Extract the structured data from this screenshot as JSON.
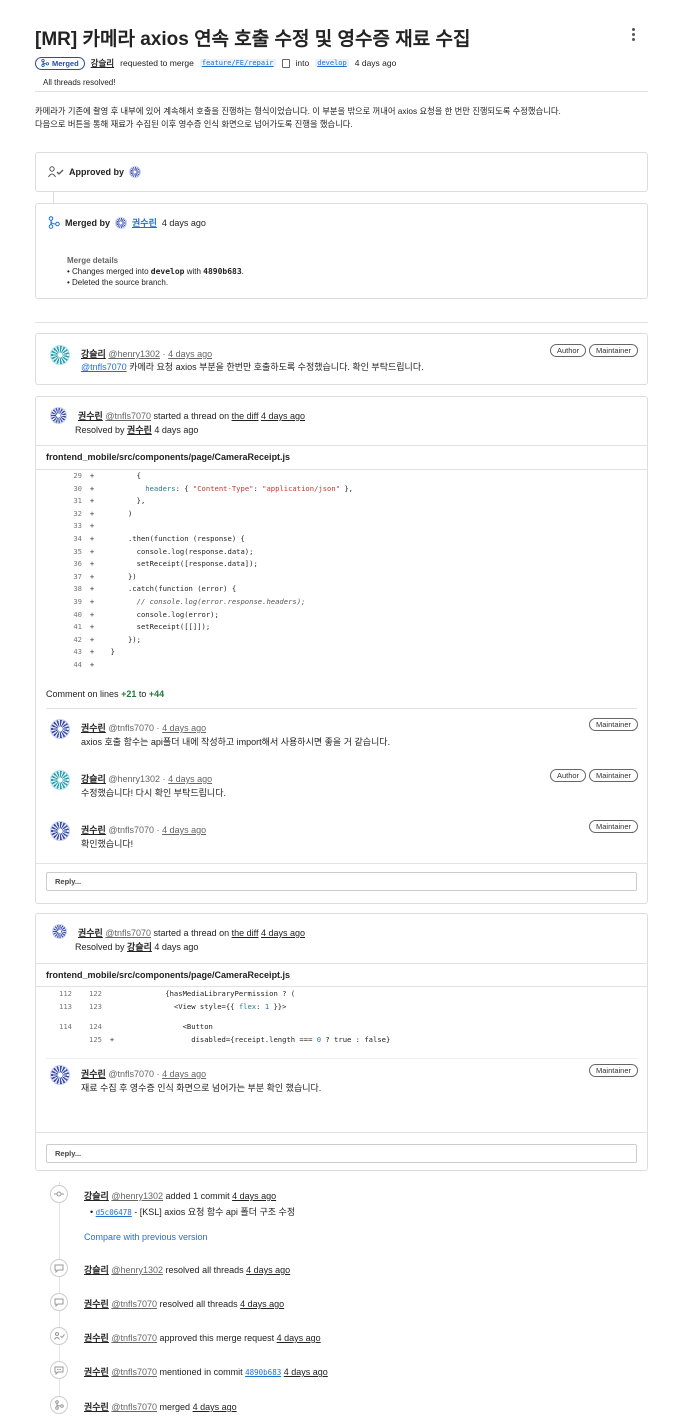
{
  "header": {
    "title": "[MR] 카메라 axios 연속 호출 수정 및 영수증 재료 수집",
    "badge": "Merged",
    "author": "강슬리",
    "requested_text": "requested to merge",
    "source_branch": "feature/FE/repair",
    "into_text": "into",
    "target_branch": "develop",
    "time": "4 days ago",
    "threads_status": "All threads resolved!"
  },
  "description": {
    "line1": "카메라가 기존에 촬영 후 내부에 있어 계속해서 호출을 진행하는 형식이었습니다. 이 부분을 밖으로 꺼내어 axios 요청을 한 번만 진행되도록 수정했습니다.",
    "line2": "다음으로 버튼을 통해 재료가 수집된 이후 영수증 인식 화면으로 넘어가도록 진행을 했습니다."
  },
  "approval": {
    "label": "Approved by"
  },
  "merge": {
    "merged_by_label": "Merged by",
    "merged_by_user": "권수린",
    "time": "4 days ago",
    "details_title": "Merge details",
    "detail1_prefix": "Changes merged into ",
    "detail1_branch": "develop",
    "detail1_mid": " with ",
    "detail1_commit": "4890b683",
    "detail1_suffix": ".",
    "detail2": "Deleted the source branch."
  },
  "comment1": {
    "author": "강슬리",
    "handle": "@henry1302",
    "sep": "·",
    "time": "4 days ago",
    "mention": "@tnfls7070",
    "body": "카메라 요청 axios 부분을 한번만 호출하도록 수정했습니다. 확인 부탁드립니다.",
    "badge_author": "Author",
    "badge_maintainer": "Maintainer"
  },
  "thread1": {
    "author": "권수린",
    "handle": "@tnfls7070",
    "started_text": "started a thread on",
    "diff_link": "the diff",
    "time": "4 days ago",
    "resolved_text": "Resolved by",
    "resolved_by": "권수린",
    "resolved_time": "4 days ago",
    "file": "frontend_mobile/src/components/page/CameraReceipt.js",
    "comment_on_text": "Comment on lines",
    "from_line": "+21",
    "to_text": "to",
    "to_line": "+44",
    "notes": [
      {
        "author": "권수린",
        "handle": "@tnfls7070",
        "sep": "·",
        "time": "4 days ago",
        "body": "axios 호출 함수는 api폴더 내에 작성하고 import해서 사용하시면 좋을 거 같습니다.",
        "badge": "Maintainer"
      },
      {
        "author": "강슬리",
        "handle": "@henry1302",
        "sep": "·",
        "time": "4 days ago",
        "body": "수정했습니다! 다시 확인 부탁드립니다.",
        "badge_author": "Author",
        "badge": "Maintainer"
      },
      {
        "author": "권수린",
        "handle": "@tnfls7070",
        "sep": "·",
        "time": "4 days ago",
        "body": "확인했습니다!",
        "badge": "Maintainer"
      }
    ],
    "reply_placeholder": "Reply..."
  },
  "thread2": {
    "author": "권수린",
    "handle": "@tnfls7070",
    "started_text": "started a thread on",
    "diff_link": "the diff",
    "time": "4 days ago",
    "resolved_text": "Resolved by",
    "resolved_by": "강슬리",
    "resolved_time": "4 days ago",
    "file": "frontend_mobile/src/components/page/CameraReceipt.js",
    "note": {
      "author": "권수린",
      "handle": "@tnfls7070",
      "sep": "·",
      "time": "4 days ago",
      "body": "재료 수집 후 영수증 인식 화면으로 넘어가는 부분 확인 했습니다.",
      "badge": "Maintainer"
    },
    "reply_placeholder": "Reply..."
  },
  "timeline": {
    "commit_event": {
      "author": "강슬리",
      "handle": "@henry1302",
      "text": "added 1 commit",
      "time": "4 days ago",
      "commit_sha": "d5c06478",
      "commit_msg": " - [KSL] axios 요청 함수 api 폴더 구조 수정",
      "compare_link": "Compare with previous version"
    },
    "events": [
      {
        "author": "강슬리",
        "handle": "@henry1302",
        "text": "resolved all threads",
        "time": "4 days ago",
        "icon": "comment-icon"
      },
      {
        "author": "권수린",
        "handle": "@tnfls7070",
        "text": "resolved all threads",
        "time": "4 days ago",
        "icon": "comment-icon"
      },
      {
        "author": "권수린",
        "handle": "@tnfls7070",
        "text": "approved this merge request",
        "time": "4 days ago",
        "icon": "approval-icon"
      },
      {
        "author": "권수린",
        "handle": "@tnfls7070",
        "text": "mentioned in commit",
        "commit": "4890b683",
        "time": "4 days ago",
        "icon": "comment-dots-icon"
      },
      {
        "author": "권수린",
        "handle": "@tnfls7070",
        "text": "merged",
        "time": "4 days ago",
        "icon": "merge-icon"
      }
    ]
  },
  "colors": {
    "link": "#1f6fd1",
    "merged_badge": "#1f4fa8",
    "added_line": "#217a3a",
    "string": "#c0392b"
  }
}
